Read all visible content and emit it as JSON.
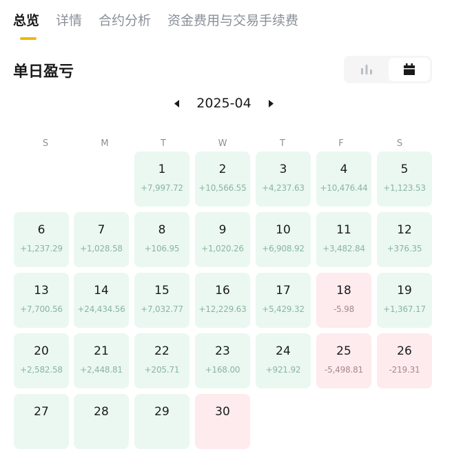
{
  "tabs": [
    {
      "label": "总览",
      "active": true
    },
    {
      "label": "详情",
      "active": false
    },
    {
      "label": "合约分析",
      "active": false
    },
    {
      "label": "资金费用与交易手续费",
      "active": false
    }
  ],
  "section_title": "单日盈亏",
  "view_toggle": {
    "options": [
      "bar-chart-icon",
      "calendar-icon"
    ],
    "selected": "calendar-icon"
  },
  "month_nav": {
    "month": "2025-04",
    "prev_icon": "caret-left-icon",
    "next_icon": "caret-right-icon"
  },
  "weekdays": [
    "S",
    "M",
    "T",
    "W",
    "T",
    "F",
    "S"
  ],
  "colors": {
    "accent": "#f0b90b",
    "profit_bg": "#eaf8f1",
    "loss_bg": "#fdebee"
  },
  "days": [
    {
      "day": "1",
      "pnl": "+7,997.72",
      "status": "profit"
    },
    {
      "day": "2",
      "pnl": "+10,566.55",
      "status": "profit"
    },
    {
      "day": "3",
      "pnl": "+4,237.63",
      "status": "profit"
    },
    {
      "day": "4",
      "pnl": "+10,476.44",
      "status": "profit"
    },
    {
      "day": "5",
      "pnl": "+1,123.53",
      "status": "profit"
    },
    {
      "day": "6",
      "pnl": "+1,237.29",
      "status": "profit"
    },
    {
      "day": "7",
      "pnl": "+1,028.58",
      "status": "profit"
    },
    {
      "day": "8",
      "pnl": "+106.95",
      "status": "profit"
    },
    {
      "day": "9",
      "pnl": "+1,020.26",
      "status": "profit"
    },
    {
      "day": "10",
      "pnl": "+6,908.92",
      "status": "profit"
    },
    {
      "day": "11",
      "pnl": "+3,482.84",
      "status": "profit"
    },
    {
      "day": "12",
      "pnl": "+376.35",
      "status": "profit"
    },
    {
      "day": "13",
      "pnl": "+7,700.56",
      "status": "profit"
    },
    {
      "day": "14",
      "pnl": "+24,434.56",
      "status": "profit"
    },
    {
      "day": "15",
      "pnl": "+7,032.77",
      "status": "profit"
    },
    {
      "day": "16",
      "pnl": "+12,229.63",
      "status": "profit"
    },
    {
      "day": "17",
      "pnl": "+5,429.32",
      "status": "profit"
    },
    {
      "day": "18",
      "pnl": "-5.98",
      "status": "loss"
    },
    {
      "day": "19",
      "pnl": "+1,367.17",
      "status": "profit"
    },
    {
      "day": "20",
      "pnl": "+2,582.58",
      "status": "profit"
    },
    {
      "day": "21",
      "pnl": "+2,448.81",
      "status": "profit"
    },
    {
      "day": "22",
      "pnl": "+205.71",
      "status": "profit"
    },
    {
      "day": "23",
      "pnl": "+168.00",
      "status": "profit"
    },
    {
      "day": "24",
      "pnl": "+921.92",
      "status": "profit"
    },
    {
      "day": "25",
      "pnl": "-5,498.81",
      "status": "loss"
    },
    {
      "day": "26",
      "pnl": "-219.31",
      "status": "loss"
    },
    {
      "day": "27",
      "pnl": "",
      "status": "profit"
    },
    {
      "day": "28",
      "pnl": "",
      "status": "profit"
    },
    {
      "day": "29",
      "pnl": "",
      "status": "profit"
    },
    {
      "day": "30",
      "pnl": "",
      "status": "loss"
    }
  ]
}
